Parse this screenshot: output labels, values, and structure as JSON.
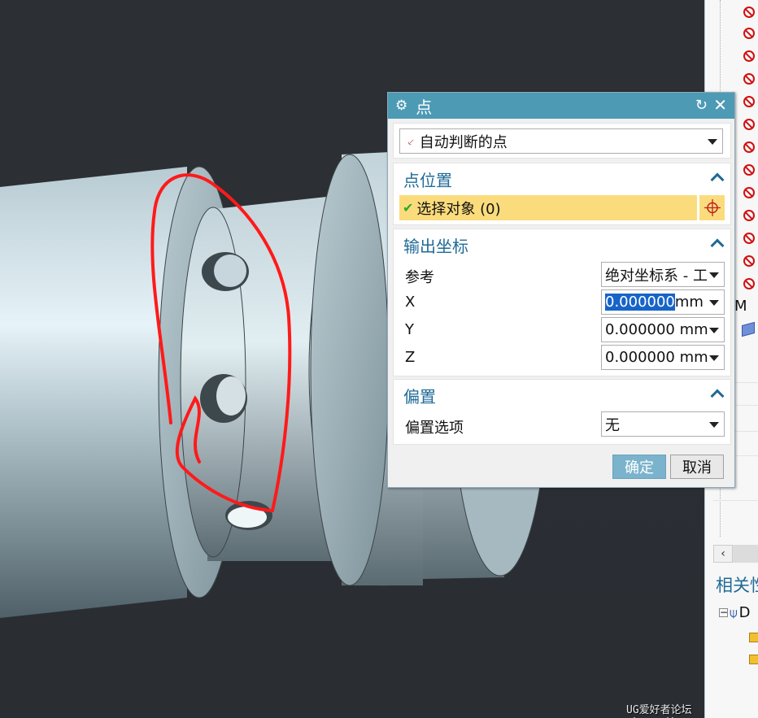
{
  "dialog": {
    "title": "点",
    "type_select": "自动判断的点",
    "point_location": {
      "heading": "点位置",
      "select_object": "选择对象 (0)"
    },
    "output_coords": {
      "heading": "输出坐标",
      "reference_label": "参考",
      "reference_value": "绝对坐标系 - 工",
      "x_label": "X",
      "x_value_selected": "0.000000",
      "x_unit": " mm",
      "y_label": "Y",
      "y_value": "0.000000 mm",
      "z_label": "Z",
      "z_value": "0.000000 mm"
    },
    "offset": {
      "heading": "偏置",
      "option_label": "偏置选项",
      "option_value": "无"
    },
    "ok_label": "确定",
    "cancel_label": "取消"
  },
  "navigator": {
    "row_m": "M",
    "related_title": "相关性",
    "dep_row": "D"
  },
  "watermark": "UG爱好者论坛@kresnik",
  "colors": {
    "titlebar": "#4d9ab5",
    "section_heading": "#1f6a97",
    "selection_bar": "#fbdc7c",
    "annotation": "#ff1a1a",
    "ok_button": "#7bb3cc"
  },
  "icons": [
    "gear-icon",
    "reset-icon",
    "close-icon",
    "point-type-icon",
    "check-icon",
    "crosshair-icon",
    "collapse-icon",
    "dropdown-arrow-icon"
  ]
}
